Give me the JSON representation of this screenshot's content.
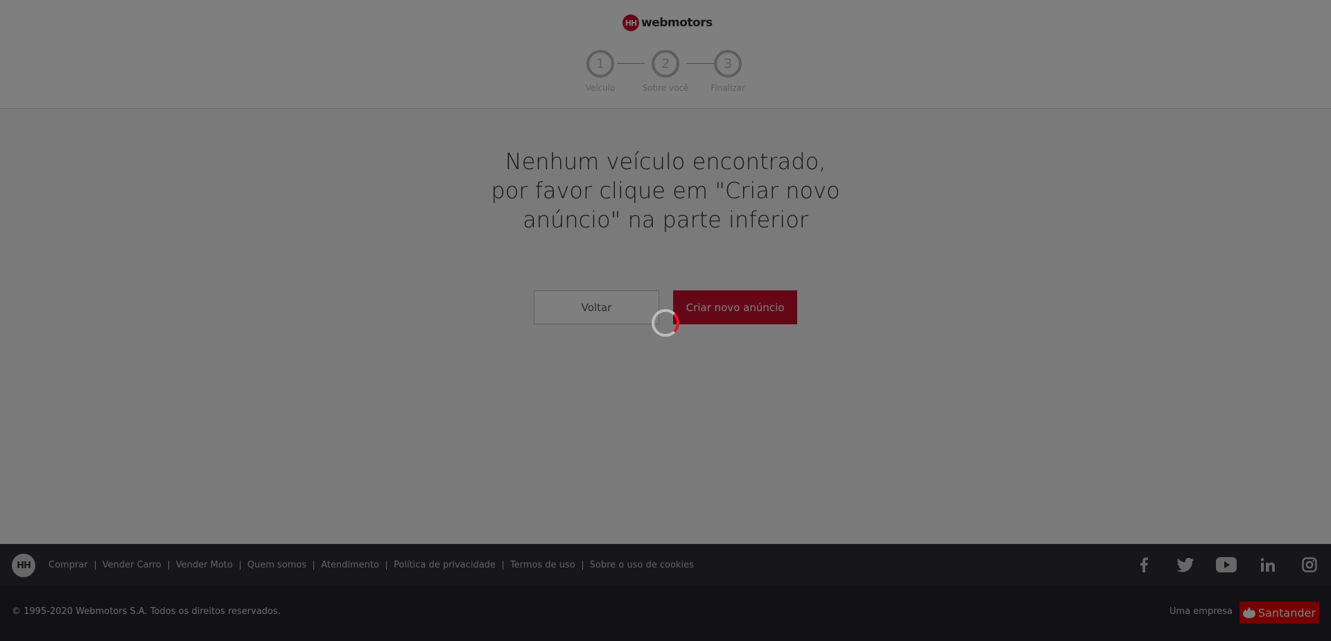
{
  "header": {
    "logo_badge": "HH",
    "logo_text": "webmotors",
    "steps": [
      {
        "number": "1",
        "label": "Veículo"
      },
      {
        "number": "2",
        "label": "Sobre você"
      },
      {
        "number": "3",
        "label": "Finalizar"
      }
    ]
  },
  "main": {
    "message": "Nenhum veículo encontrado, por favor clique em \"Criar novo anúncio\" na parte inferior",
    "back_label": "Voltar",
    "create_label": "Criar novo anúncio"
  },
  "footer": {
    "logo_badge": "HH",
    "links": [
      "Comprar",
      "Vender Carro",
      "Vender Moto",
      "Quem somos",
      "Atendimento",
      "Política de privacidade",
      "Termos de uso",
      "Sobre o uso de cookies"
    ],
    "social_icons": [
      "facebook-icon",
      "twitter-icon",
      "youtube-icon",
      "linkedin-icon",
      "instagram-icon"
    ],
    "copyright": "© 1995-2020 Webmotors S.A. Todos os direitos reservados.",
    "empresa_label": "Uma empresa",
    "santander_label": "Santander"
  },
  "colors": {
    "brand": "#c8102e",
    "footer_bg": "#2e2d37",
    "santander": "#ec0000",
    "overlay": "rgba(0,0,0,0.5)"
  },
  "state": {
    "loading": true
  }
}
